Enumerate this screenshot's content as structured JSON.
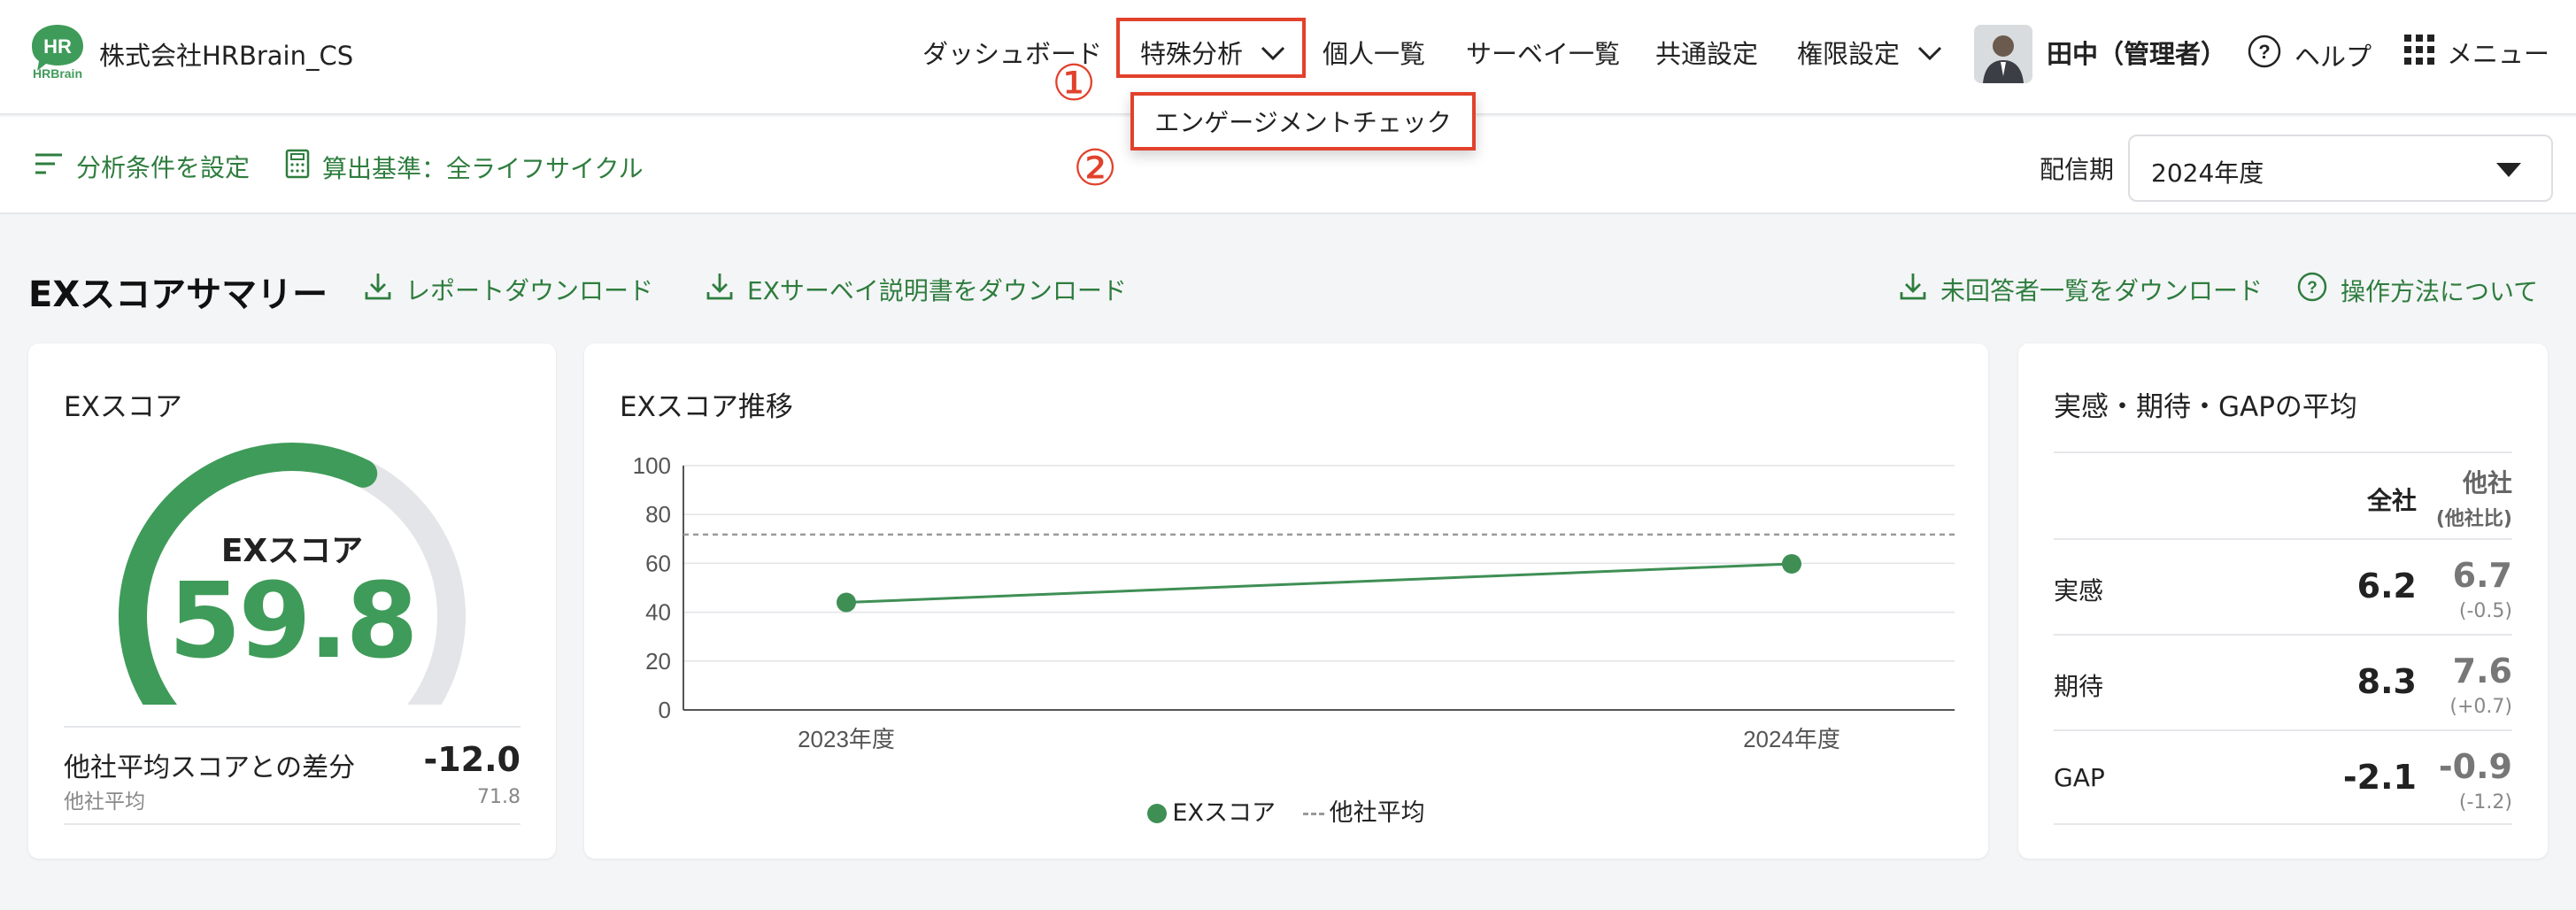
{
  "header": {
    "logo_text_top": "HR",
    "logo_text_bottom": "HRBrain",
    "company": "株式会社HRBrain_CS",
    "nav": {
      "dashboard": "ダッシュボード",
      "special_analysis": "特殊分析",
      "individual_list": "個人一覧",
      "survey_list": "サーベイ一覧",
      "common_settings": "共通設定",
      "permission_settings": "権限設定"
    },
    "user_name": "田中（管理者）",
    "help": "ヘルプ",
    "menu": "メニュー"
  },
  "dropdown": {
    "item": "エンゲージメントチェック"
  },
  "annotations": {
    "step1": "①",
    "step2": "②",
    "highlight_color": "#e2412c"
  },
  "toolbar": {
    "analysis_conditions": "分析条件を設定",
    "calc_basis": "算出基準：全ライフサイクル",
    "period_label": "配信期",
    "period_value": "2024年度"
  },
  "section": {
    "title": "EXスコアサマリー",
    "report_download": "レポートダウンロード",
    "ex_survey_doc_download": "EXサーベイ説明書をダウンロード",
    "unanswered_download": "未回答者一覧をダウンロード",
    "how_to": "操作方法について"
  },
  "score_card": {
    "title": "EXスコア",
    "gauge_label": "EXスコア",
    "gauge_value": "59.8",
    "gauge_fraction": 0.598,
    "diff_label": "他社平均スコアとの差分",
    "diff_value": "-12.0",
    "diff_sub_label": "他社平均",
    "diff_sub_value": "71.8"
  },
  "trend_card": {
    "title": "EXスコア推移",
    "legend_score": "EXスコア",
    "legend_avg": "他社平均"
  },
  "chart_data": {
    "type": "line",
    "title": "EXスコア推移",
    "categories": [
      "2023年度",
      "2024年度"
    ],
    "series": [
      {
        "name": "EXスコア",
        "values": [
          44,
          59.8
        ]
      },
      {
        "name": "他社平均",
        "values": [
          71.8,
          71.8
        ],
        "style": "dashed"
      }
    ],
    "ylim": [
      0,
      100
    ],
    "yticks": [
      0,
      20,
      40,
      60,
      80,
      100
    ],
    "grid": true,
    "legend": "bottom-center",
    "colors": {
      "score": "#3f8f55",
      "average": "#9a9a9a"
    }
  },
  "gap_card": {
    "title": "実感・期待・GAPの平均",
    "col_all": "全社",
    "col_other": "他社",
    "col_other_sub": "(他社比)",
    "rows": [
      {
        "label": "実感",
        "all": "6.2",
        "other": "6.7",
        "diff": "(-0.5)"
      },
      {
        "label": "期待",
        "all": "8.3",
        "other": "7.6",
        "diff": "(+0.7)"
      },
      {
        "label": "GAP",
        "all": "-2.1",
        "other": "-0.9",
        "diff": "(-1.2)"
      }
    ]
  },
  "colors": {
    "brand_green": "#3f9b59",
    "link_green": "#2e7d3e"
  }
}
